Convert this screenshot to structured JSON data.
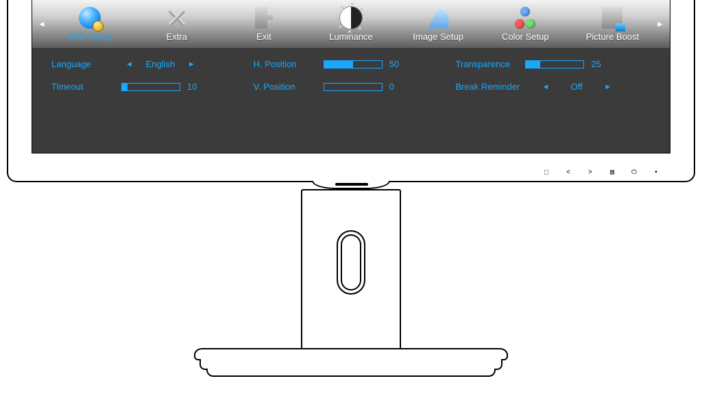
{
  "tabs": {
    "osd_setup": "OSD Setup",
    "extra": "Extra",
    "exit": "Exit",
    "luminance": "Luminance",
    "image_setup": "Image Setup",
    "color_setup": "Color Setup",
    "picture_boost": "Picture Boost"
  },
  "settings": {
    "language_label": "Language",
    "language_value": "English",
    "timeout_label": "Timeout",
    "timeout_value": "10",
    "timeout_pct": 10,
    "hpos_label": "H. Position",
    "hpos_value": "50",
    "hpos_pct": 50,
    "vpos_label": "V. Position",
    "vpos_value": "0",
    "vpos_pct": 0,
    "transp_label": "Transparence",
    "transp_value": "25",
    "transp_pct": 25,
    "break_label": "Break Reminder",
    "break_value": "Off"
  },
  "front_buttons": {
    "b1": "⬚",
    "b2": "<",
    "b3": ">",
    "b4": "▤",
    "b5": "⏻",
    "b6": "•"
  }
}
